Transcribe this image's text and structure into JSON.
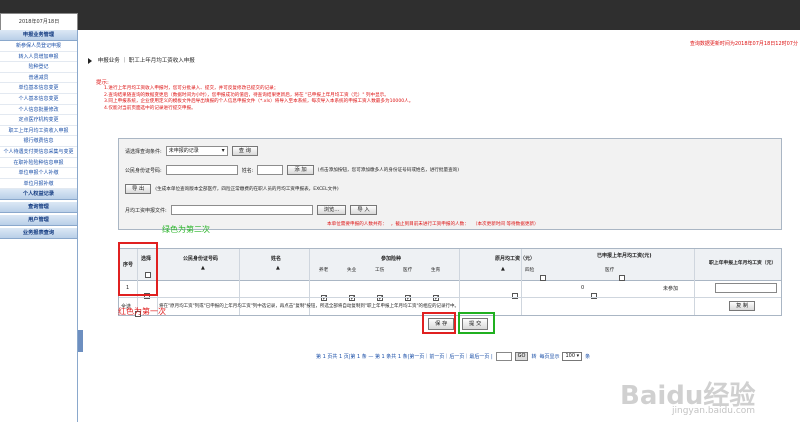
{
  "header": {
    "date": "2018年07月18日"
  },
  "sidebar": {
    "section1": "申报业务管理",
    "items": [
      "新参保人员登记申报",
      "转入人员增加申报",
      "险种登记",
      "普通减员",
      "单位基本信息变更",
      "个人基本信息变更",
      "个人信息批量修改",
      "定点医疗机构变更",
      "职工上年月均工资收入申报",
      "银行缴费信息",
      "个人待遇支付类信息采集与变更",
      "在职补险险种信息申报",
      "单位申报个人补缴",
      "单位月报补缴"
    ],
    "section2": "个人权益记录",
    "section3": "查询管理",
    "section4": "用户管理",
    "section5": "业务报表查询"
  },
  "breadcrumb": {
    "part1": "申报业务",
    "sep": "｜",
    "part2": "职工上年月均工资收入申报"
  },
  "update_time": "查询数据更新时间为2018年07月18日12时07分",
  "tips": {
    "title": "提示:",
    "lines": [
      "1.进行上年月均工资收入申报时，您可分批录入、提交，并可反复修改已提交的记录；",
      "2.查询结果随查询的数据变更后（数据时间为小时），您申报成功的值后，待查询结果更新后，将在 \"已申报上年月均工资（元）\" 列中显示。",
      "3.同上申报系统，企业使用定义的模板文件后导出填报的个人信息申报文件（*.xls）将导入至本系统，每次导入本系统的申报工资人数最多为10000人。",
      "4.仅能对当前页面选中的记录进行提交申报。"
    ]
  },
  "query": {
    "condition_label": "请选择查询条件:",
    "condition_value": "未申报的记录",
    "query_button": "查 询",
    "idcard_label": "公民身份证号码:",
    "name_label": "姓名:",
    "add_button": "添 加",
    "add_note": "(点击添加按钮，您可添加缴多人的身份证号码或姓名，进行批量查询)",
    "export_button": "导 出",
    "export_note": "(生成本单位查询版本全部医疗，四险正常缴费的在职人员的月均工资申报表，EXCEL文件)",
    "file_label": "月均工资申报文件:",
    "browse_button": "浏览...",
    "import_button": "导 入",
    "red_note_a": "本单位需要申报的人数共有：",
    "red_note_b": "，截止到目前未进行工资申报的人数：",
    "red_note_c": "（本次更新时间 等待数据更新）"
  },
  "table": {
    "col_seq": "序号",
    "col_select": "选择",
    "col_idcard": "公民身份证号码",
    "col_name": "姓名",
    "col_insure": "参加险种",
    "insure_types": [
      "养老",
      "失业",
      "工伤",
      "医疗",
      "生育"
    ],
    "col_last_wage": "原月均工资（元）",
    "col_declared": "已申报上年月均工资(元)",
    "declared_sub": [
      "四险",
      "医疗"
    ],
    "col_new_wage": "职上年申报上年月均工资（元）",
    "row": {
      "seq": "1",
      "wage": "0",
      "status": "未参加"
    },
    "select_all": "全选",
    "footnote": "将在\"原月均工资\"列或\"已申报的上年月均工资\"列中选记录，再点击\"复制\"按钮，所选全部将自动复制到\"职上年申报上年月均工资\"的相应的记录行中。",
    "copy_button": "复 制"
  },
  "actions": {
    "save": "保 存",
    "submit": "提 交"
  },
  "annotations": {
    "green": "绿色为第二次",
    "red": "红色为第一次"
  },
  "pager": {
    "text": "第 1 页共 1 页|第 1 条 — 第 1 条共 1 条|第一页｜前一页｜后一页｜最后一页 |",
    "go_label": "GO",
    "jump": "转",
    "size_label": "每页显示",
    "size_value": "100 ▾",
    "size_suffix": "条"
  },
  "watermark": {
    "main": "Baidu经验",
    "sub": "jingyan.baidu.com"
  }
}
